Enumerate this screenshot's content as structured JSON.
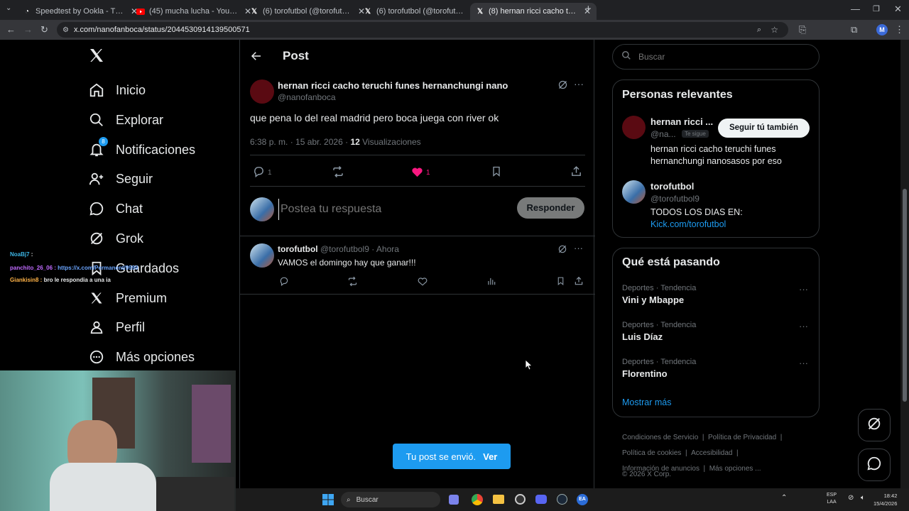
{
  "browser": {
    "tabs": [
      {
        "title": "Speedtest by Ookla - The Globa",
        "icon": "speedtest-icon"
      },
      {
        "title": "(45) mucha lucha - YouTube",
        "icon": "youtube-icon"
      },
      {
        "title": "(6) torofutbol (@torofutbol9) /",
        "icon": "x-icon"
      },
      {
        "title": "(6) torofutbol (@torofutbol9) /",
        "icon": "x-icon"
      },
      {
        "title": "(8) hernan ricci cacho teruchi fu",
        "icon": "x-icon"
      }
    ],
    "url": "x.com/nanofanboca/status/2044530914139500571"
  },
  "sidebar": {
    "items": [
      {
        "label": "Inicio",
        "icon": "home-icon"
      },
      {
        "label": "Explorar",
        "icon": "search-icon"
      },
      {
        "label": "Notificaciones",
        "icon": "bell-icon",
        "badge": "8"
      },
      {
        "label": "Seguir",
        "icon": "follow-icon"
      },
      {
        "label": "Chat",
        "icon": "chat-icon"
      },
      {
        "label": "Grok",
        "icon": "grok-icon"
      },
      {
        "label": "Guardados",
        "icon": "bookmark-icon"
      },
      {
        "label": "Premium",
        "icon": "x-logo-icon"
      },
      {
        "label": "Perfil",
        "icon": "person-icon"
      },
      {
        "label": "Más opciones",
        "icon": "more-circle-icon"
      }
    ]
  },
  "overlay_chat": [
    {
      "user": "NoaBj7",
      "text": ":"
    },
    {
      "user": "panchito_26_06 :",
      "text": "https://x.com/Permanent/9999"
    },
    {
      "user": "Giankisin8 :",
      "text": "bro le respondia a una ia"
    }
  ],
  "main": {
    "header_title": "Post",
    "post": {
      "display_name": "hernan ricci cacho teruchi funes hernanchungi nano",
      "handle": "@nanofanboca",
      "text": "que pena lo del real madrid pero boca juega con river ok",
      "time": "6:38 p. m. · 15 abr. 2026 ·",
      "views_count": "12",
      "views_label": "Visualizaciones",
      "replies": "1",
      "likes": "1"
    },
    "composer": {
      "placeholder": "Postea tu respuesta",
      "button": "Responder"
    },
    "reply": {
      "display_name": "torofutbol",
      "handle": "@torofutbol9",
      "time": "· Ahora",
      "text": "VAMOS el domingo hay que ganar!!!"
    },
    "toast": {
      "text": "Tu post se envió.",
      "action": "Ver"
    }
  },
  "right": {
    "search_placeholder": "Buscar",
    "relevant": {
      "title": "Personas relevantes",
      "people": [
        {
          "name": "hernan ricci ...",
          "handle": "@na...",
          "follows_you": "Te sigue",
          "button": "Seguir tú también",
          "bio": "hernan ricci cacho teruchi funes hernanchungi nanosasos por eso"
        },
        {
          "name": "torofutbol",
          "handle": "@torofutbol9",
          "bio": "TODOS LOS DIAS EN:",
          "link": "Kick.com/torofutbol"
        }
      ]
    },
    "trends": {
      "title": "Qué está pasando",
      "items": [
        {
          "category": "Deportes · Tendencia",
          "name": "Vini y Mbappe"
        },
        {
          "category": "Deportes · Tendencia",
          "name": "Luis Díaz"
        },
        {
          "category": "Deportes · Tendencia",
          "name": "Florentino"
        }
      ],
      "show_more": "Mostrar más"
    },
    "footer": {
      "links": [
        "Condiciones de Servicio",
        "Política de Privacidad",
        "Política de cookies",
        "Accesibilidad",
        "Información de anuncios",
        "Más opciones ..."
      ],
      "copyright": "© 2026 X Corp."
    }
  },
  "taskbar": {
    "search": "Buscar",
    "lang": "ESP",
    "lang2": "LAA",
    "time": "18:42",
    "date": "15/4/2026"
  },
  "colors": {
    "accent": "#1d9bf0",
    "like": "#f91880",
    "bg": "#000000",
    "border": "#2f3336"
  }
}
